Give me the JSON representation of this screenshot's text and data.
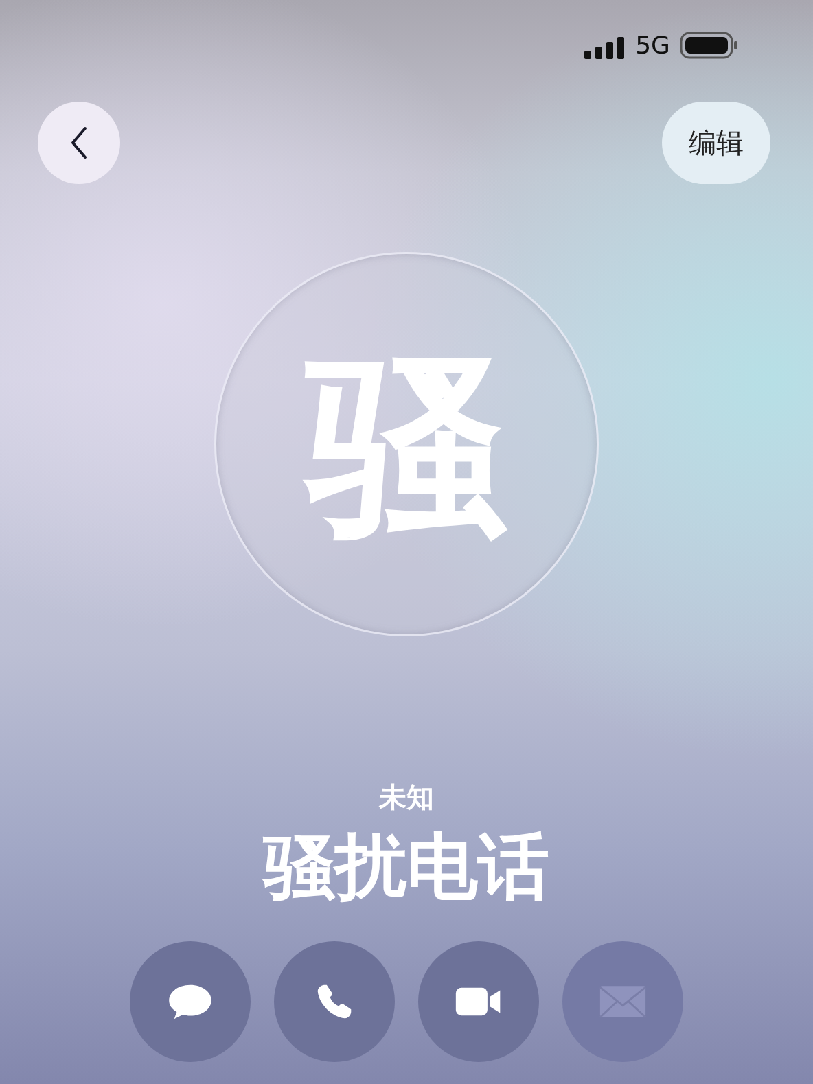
{
  "status_bar": {
    "network": "5G"
  },
  "edit_button": {
    "label": "编辑"
  },
  "avatar": {
    "initial": "骚"
  },
  "contact": {
    "label": "未知",
    "name": "骚扰电话"
  },
  "actions": [
    {
      "kind": "message",
      "disabled": false
    },
    {
      "kind": "call",
      "disabled": false
    },
    {
      "kind": "video",
      "disabled": false
    },
    {
      "kind": "mail",
      "disabled": true
    }
  ]
}
